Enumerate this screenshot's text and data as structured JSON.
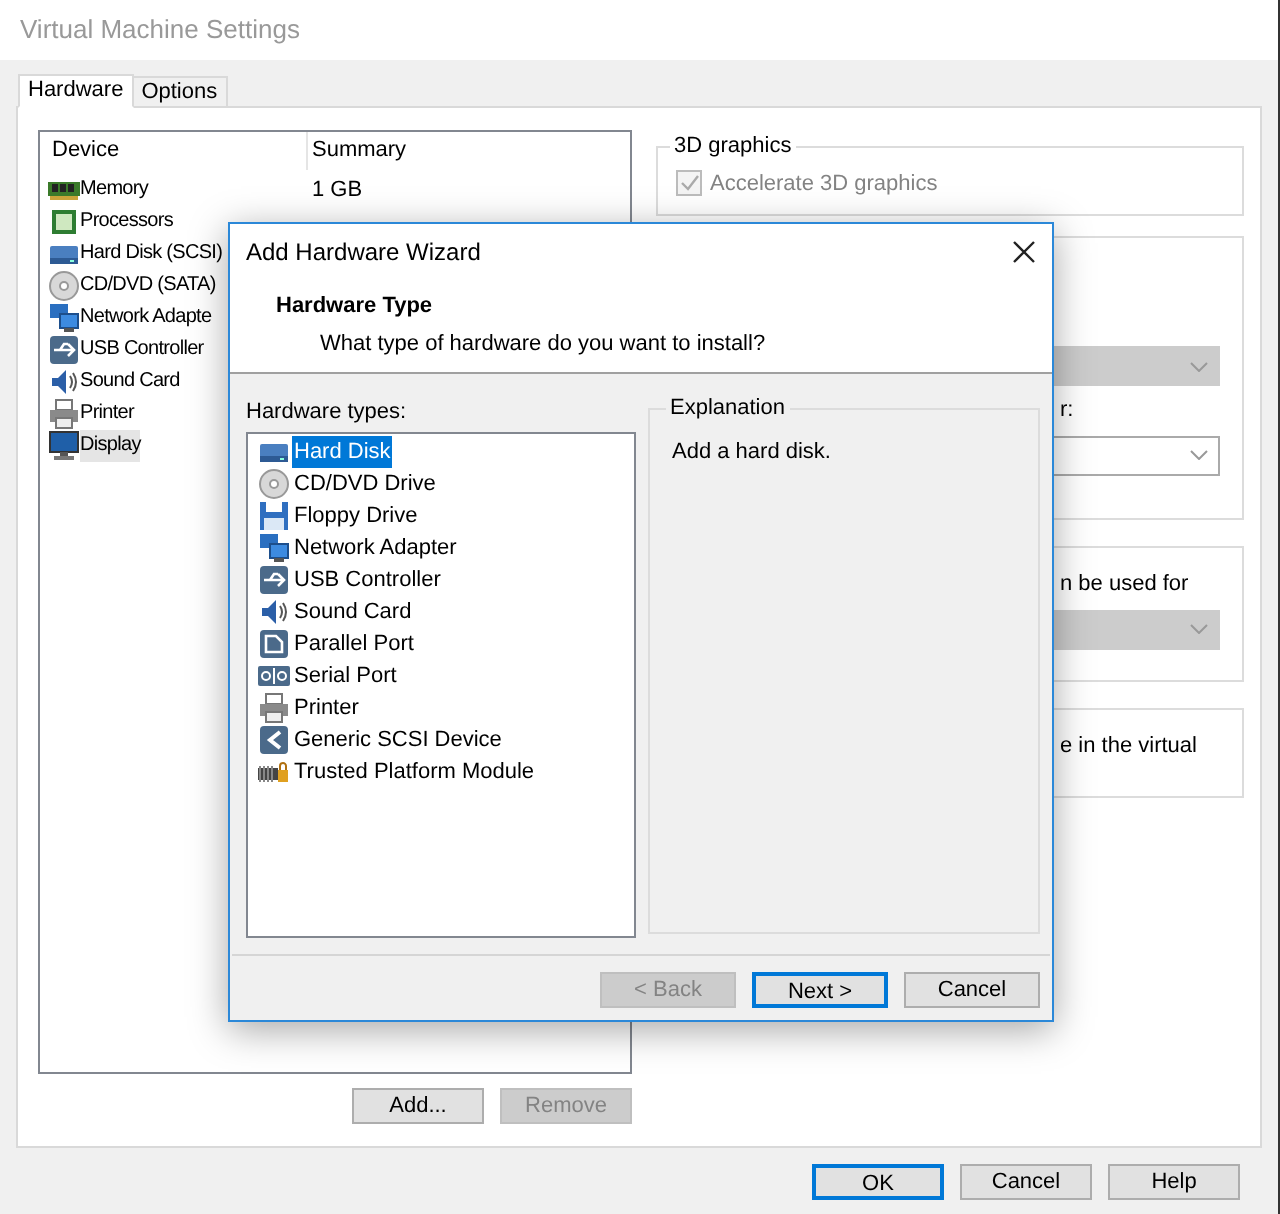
{
  "window": {
    "title": "Virtual Machine Settings"
  },
  "tabs": [
    {
      "label": "Hardware",
      "selected": true
    },
    {
      "label": "Options",
      "selected": false
    }
  ],
  "device_table": {
    "columns": [
      "Device",
      "Summary"
    ],
    "rows": [
      {
        "kind": "memory",
        "device": "Memory",
        "summary": "1 GB",
        "selected": false
      },
      {
        "kind": "processor",
        "device": "Processors",
        "selected": false
      },
      {
        "kind": "harddisk",
        "device": "Hard Disk (SCSI)",
        "selected": false
      },
      {
        "kind": "cd",
        "device": "CD/DVD (SATA)",
        "selected": false
      },
      {
        "kind": "network",
        "device": "Network Adapte",
        "selected": false
      },
      {
        "kind": "usb",
        "device": "USB Controller",
        "selected": false
      },
      {
        "kind": "sound",
        "device": "Sound Card",
        "selected": false
      },
      {
        "kind": "printer",
        "device": "Printer",
        "selected": false
      },
      {
        "kind": "display",
        "device": "Display",
        "selected": true
      }
    ]
  },
  "device_buttons": [
    {
      "label": "Add...",
      "disabled": false
    },
    {
      "label": "Remove",
      "disabled": true
    }
  ],
  "settings_groups": [
    {
      "kind": "checkbox_group",
      "title": "3D graphics",
      "checkbox": {
        "label": "Accelerate 3D graphics",
        "checked": true,
        "disabled": true
      }
    },
    {
      "kind": "partial",
      "items": [
        {
          "kind": "dropdown",
          "disabled": true
        },
        {
          "kind": "text",
          "text": "r:"
        },
        {
          "kind": "dropdown",
          "disabled": false
        }
      ]
    },
    {
      "kind": "partial",
      "items": [
        {
          "kind": "text",
          "text": "n be used for"
        },
        {
          "kind": "dropdown",
          "disabled": true
        }
      ]
    },
    {
      "kind": "partial",
      "items": [
        {
          "kind": "text",
          "text": "e in the virtual"
        }
      ]
    }
  ],
  "dialog_buttons": [
    {
      "label": "OK",
      "default": true
    },
    {
      "label": "Cancel",
      "default": false
    },
    {
      "label": "Help",
      "default": false
    }
  ],
  "wizard": {
    "title": "Add Hardware Wizard",
    "heading": "Hardware Type",
    "subtitle": "What type of hardware do you want to install?",
    "list_label": "Hardware types:",
    "hardware_types": [
      {
        "kind": "harddisk",
        "label": "Hard Disk",
        "selected": true
      },
      {
        "kind": "cd",
        "label": "CD/DVD Drive",
        "selected": false
      },
      {
        "kind": "floppy",
        "label": "Floppy Drive",
        "selected": false
      },
      {
        "kind": "network",
        "label": "Network Adapter",
        "selected": false
      },
      {
        "kind": "usb",
        "label": "USB Controller",
        "selected": false
      },
      {
        "kind": "sound",
        "label": "Sound Card",
        "selected": false
      },
      {
        "kind": "parallel",
        "label": "Parallel Port",
        "selected": false
      },
      {
        "kind": "serial",
        "label": "Serial Port",
        "selected": false
      },
      {
        "kind": "printer",
        "label": "Printer",
        "selected": false
      },
      {
        "kind": "scsi",
        "label": "Generic SCSI Device",
        "selected": false
      },
      {
        "kind": "tpm",
        "label": "Trusted Platform Module",
        "selected": false
      }
    ],
    "explanation": {
      "title": "Explanation",
      "text": "Add a hard disk."
    },
    "buttons": [
      {
        "label": "< Back",
        "disabled": true,
        "default": false
      },
      {
        "label": "Next >",
        "disabled": false,
        "default": true
      },
      {
        "label": "Cancel",
        "disabled": false,
        "default": false
      }
    ]
  }
}
